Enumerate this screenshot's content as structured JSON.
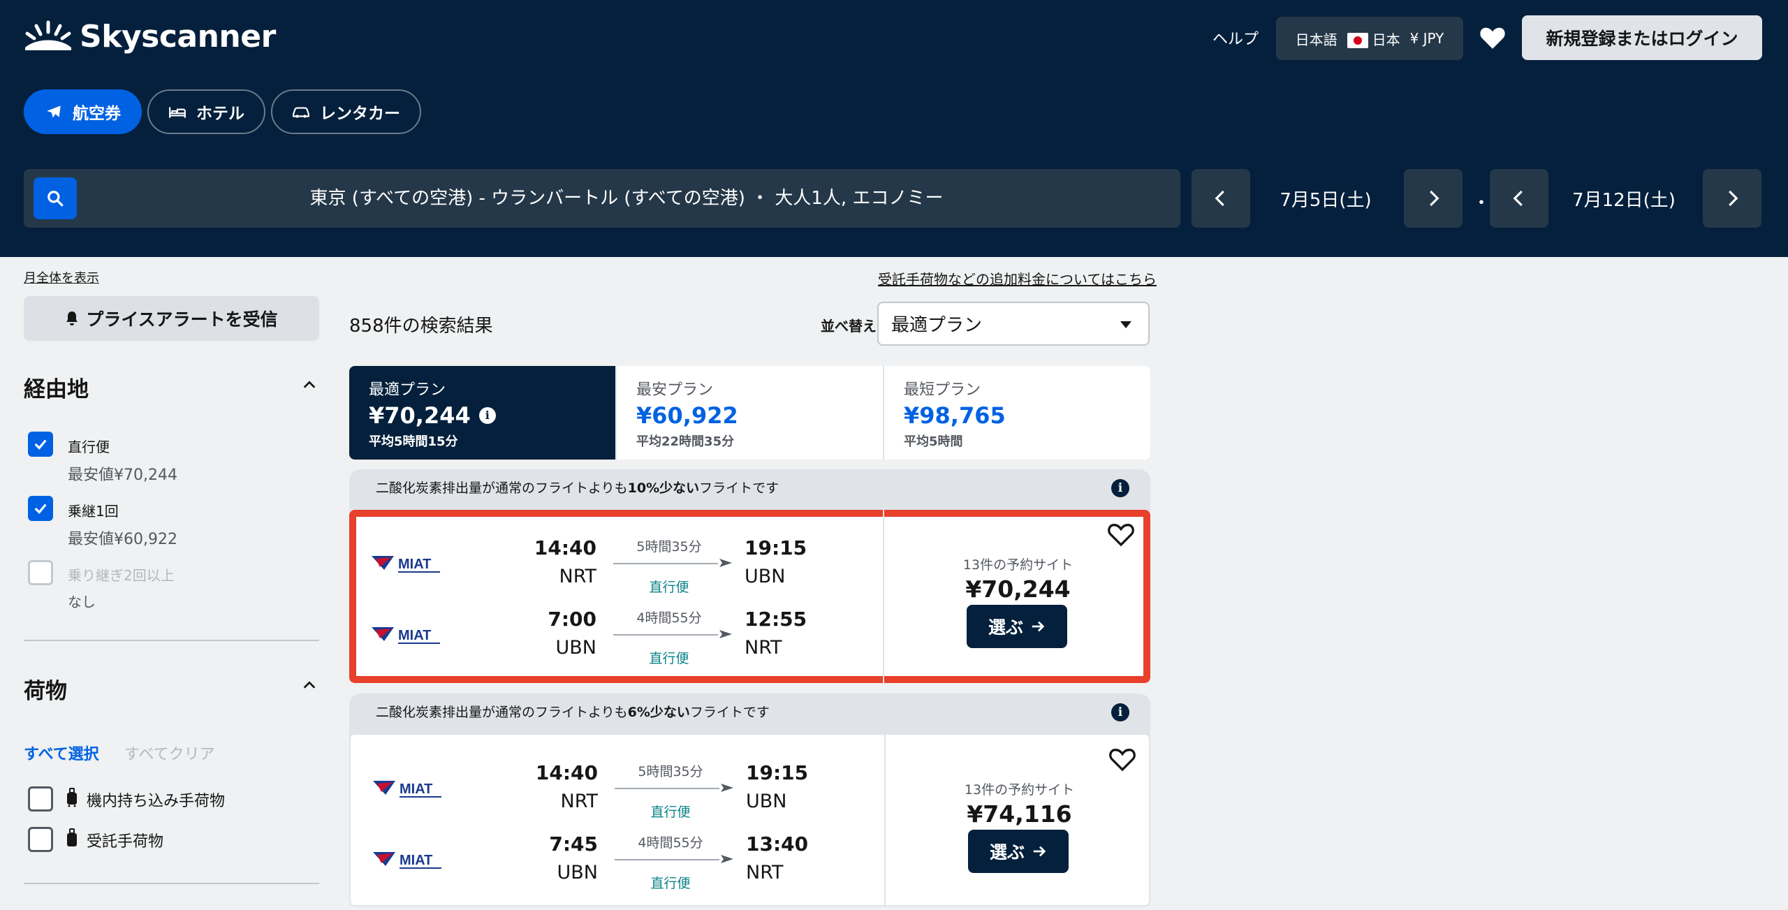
{
  "header": {
    "brand": "Skyscanner",
    "help": "ヘルプ",
    "language": "日本語",
    "region": "日本",
    "currency": "¥ JPY",
    "login": "新規登録またはログイン"
  },
  "tabs": [
    {
      "label": "航空券",
      "icon": "plane-icon",
      "active": true
    },
    {
      "label": "ホテル",
      "icon": "bed-icon",
      "active": false
    },
    {
      "label": "レンタカー",
      "icon": "car-icon",
      "active": false
    }
  ],
  "search": {
    "summary": "東京 (すべての空港) - ウランバートル (すべての空港) ・ 大人1人, エコノミー",
    "depart_date": "7月5日(土)",
    "return_date": "7月12日(土)",
    "separator": "・"
  },
  "sidebar": {
    "month_link": "月全体を表示",
    "price_alert": "プライスアラートを受信",
    "stops": {
      "title": "経由地",
      "options": [
        {
          "label": "直行便",
          "sub": "最安値¥70,244",
          "checked": true
        },
        {
          "label": "乗継1回",
          "sub": "最安値¥60,922",
          "checked": true
        },
        {
          "label": "乗り継ぎ2回以上",
          "sub": "なし",
          "checked": false
        }
      ]
    },
    "baggage": {
      "title": "荷物",
      "select_all": "すべて選択",
      "clear_all": "すべてクリア",
      "options": [
        {
          "label": "機内持ち込み手荷物"
        },
        {
          "label": "受託手荷物"
        }
      ]
    }
  },
  "results": {
    "extra_fees_link": "受託手荷物などの追加料金についてはこちら",
    "count": "858件の検索結果",
    "sort_label": "並べ替え",
    "sort_value": "最適プラン",
    "plans": [
      {
        "name": "最適プラン",
        "price": "¥70,244",
        "duration": "平均5時間15分",
        "active": true
      },
      {
        "name": "最安プラン",
        "price": "¥60,922",
        "duration": "平均22時間35分",
        "active": false
      },
      {
        "name": "最短プラン",
        "price": "¥98,765",
        "duration": "平均5時間",
        "active": false
      }
    ],
    "cards": [
      {
        "eco_prefix": "二酸化炭素排出量が通常のフライトよりも",
        "eco_bold": "10%少ない",
        "eco_suffix": "フライトです",
        "airline": "MIAT",
        "legs": [
          {
            "dep_time": "14:40",
            "dep_airport": "NRT",
            "duration": "5時間35分",
            "stops": "直行便",
            "arr_time": "19:15",
            "arr_airport": "UBN"
          },
          {
            "dep_time": "7:00",
            "dep_airport": "UBN",
            "duration": "4時間55分",
            "stops": "直行便",
            "arr_time": "12:55",
            "arr_airport": "NRT"
          }
        ],
        "sites": "13件の予約サイト",
        "price": "¥70,244",
        "select": "選ぶ"
      },
      {
        "eco_prefix": "二酸化炭素排出量が通常のフライトよりも",
        "eco_bold": "6%少ない",
        "eco_suffix": "フライトです",
        "airline": "MIAT",
        "legs": [
          {
            "dep_time": "14:40",
            "dep_airport": "NRT",
            "duration": "5時間35分",
            "stops": "直行便",
            "arr_time": "19:15",
            "arr_airport": "UBN"
          },
          {
            "dep_time": "7:45",
            "dep_airport": "UBN",
            "duration": "4時間55分",
            "stops": "直行便",
            "arr_time": "13:40",
            "arr_airport": "NRT"
          }
        ],
        "sites": "13件の予約サイト",
        "price": "¥74,116",
        "select": "選ぶ"
      }
    ]
  },
  "colors": {
    "header_bg": "#05203c",
    "accent": "#0062e3",
    "highlight": "#e8402b",
    "direct": "#0c838a"
  }
}
